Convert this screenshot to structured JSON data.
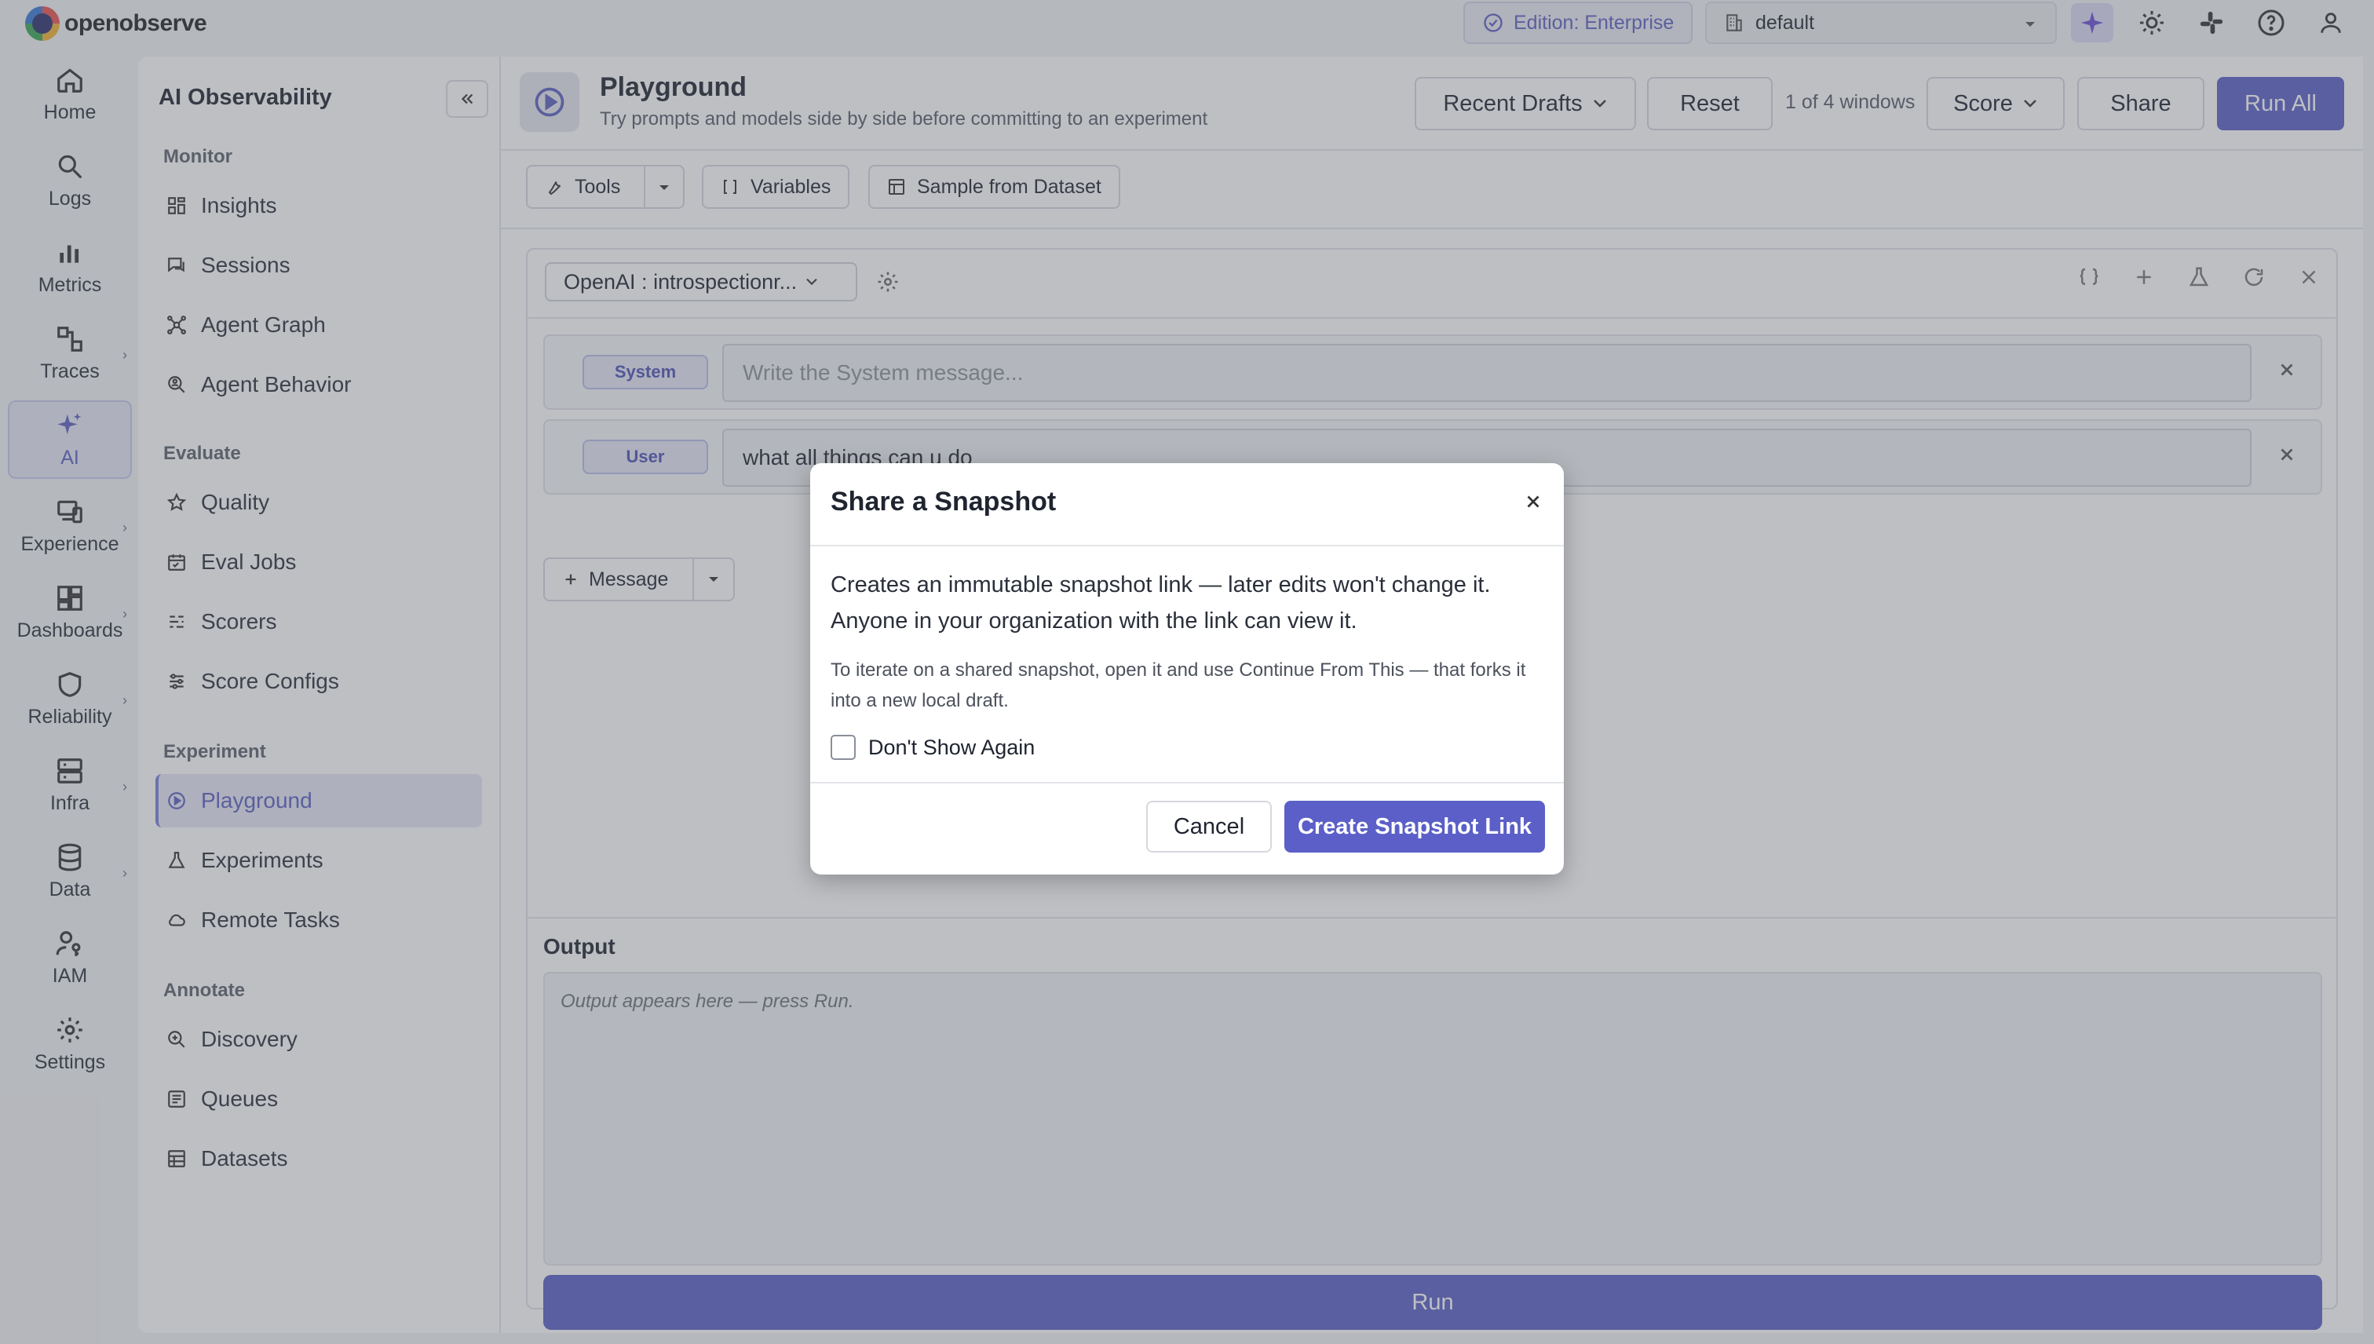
{
  "app": {
    "name": "openobserve"
  },
  "topbar": {
    "edition": "Edition: Enterprise",
    "org": "default"
  },
  "leftnav": [
    {
      "label": "Home",
      "icon": "home-icon"
    },
    {
      "label": "Logs",
      "icon": "search-icon"
    },
    {
      "label": "Metrics",
      "icon": "bar-chart-icon"
    },
    {
      "label": "Traces",
      "icon": "traces-icon"
    },
    {
      "label": "AI",
      "icon": "sparkle-icon",
      "active": true
    },
    {
      "label": "Experience",
      "icon": "devices-icon"
    },
    {
      "label": "Dashboards",
      "icon": "dashboard-icon"
    },
    {
      "label": "Reliability",
      "icon": "shield-icon"
    },
    {
      "label": "Infra",
      "icon": "server-icon"
    },
    {
      "label": "Data",
      "icon": "database-icon"
    },
    {
      "label": "IAM",
      "icon": "user-key-icon"
    },
    {
      "label": "Settings",
      "icon": "gear-icon"
    }
  ],
  "sidebar": {
    "title": "AI Observability",
    "sections": {
      "monitor": "Monitor",
      "evaluate": "Evaluate",
      "experiment": "Experiment",
      "annotate": "Annotate"
    },
    "items": {
      "insights": "Insights",
      "sessions": "Sessions",
      "agent_graph": "Agent Graph",
      "agent_behavior": "Agent Behavior",
      "quality": "Quality",
      "eval_jobs": "Eval Jobs",
      "scorers": "Scorers",
      "score_configs": "Score Configs",
      "playground": "Playground",
      "experiments": "Experiments",
      "remote_tasks": "Remote Tasks",
      "discovery": "Discovery",
      "queues": "Queues",
      "datasets": "Datasets"
    }
  },
  "header": {
    "title": "Playground",
    "subtitle": "Try prompts and models side by side before committing to an experiment",
    "recent_drafts": "Recent Drafts",
    "reset": "Reset",
    "windows": "1 of 4 windows",
    "score": "Score",
    "share": "Share",
    "run_all": "Run All"
  },
  "toolbar": {
    "tools": "Tools",
    "variables": "Variables",
    "sample": "Sample from Dataset"
  },
  "window": {
    "model": "OpenAI : introspectionr...",
    "system_role": "System",
    "system_placeholder": "Write the System message...",
    "user_role": "User",
    "user_message": "what all things can u do",
    "add_message": "Message",
    "output_label": "Output",
    "output_placeholder": "Output appears here — press Run.",
    "run": "Run"
  },
  "dialog": {
    "title": "Share a Snapshot",
    "body1": "Creates an immutable snapshot link — later edits won't change it. Anyone in your organization with the link can view it.",
    "body2": "To iterate on a shared snapshot, open it and use Continue From This — that forks it into a new local draft.",
    "checkbox": "Don't Show Again",
    "cancel": "Cancel",
    "create": "Create Snapshot Link"
  },
  "colors": {
    "accent": "#5b5fc7",
    "accent_light": "#e6e6f5",
    "logo_dark": "#2a2f6b"
  }
}
